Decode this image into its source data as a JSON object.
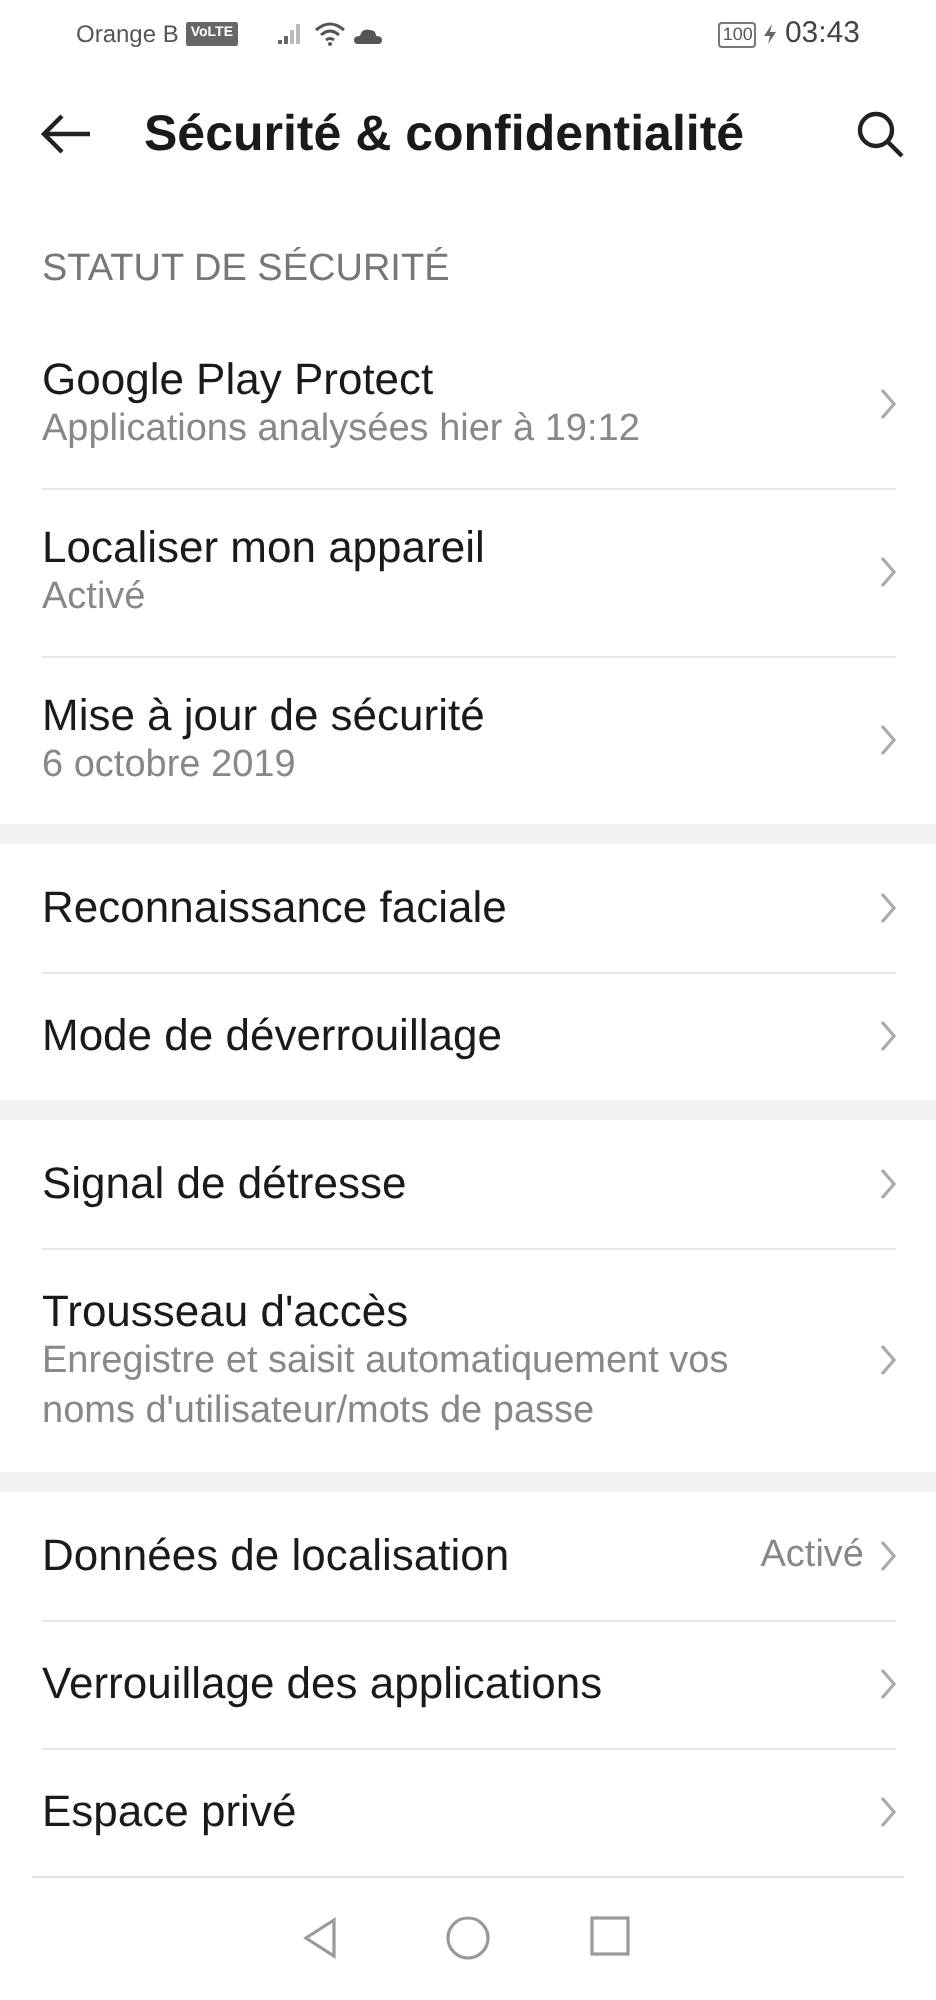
{
  "status_bar": {
    "carrier": "Orange B",
    "volte": "VoLTE",
    "battery": "100",
    "time": "03:43"
  },
  "header": {
    "title": "Sécurité & confidentialité"
  },
  "groups": [
    {
      "heading": "STATUT DE SÉCURITÉ",
      "items": [
        {
          "title": "Google Play Protect",
          "subtitle": "Applications analysées hier à 19:12"
        },
        {
          "title": "Localiser mon appareil",
          "subtitle": "Activé"
        },
        {
          "title": "Mise à jour de sécurité",
          "subtitle": "6 octobre 2019"
        }
      ]
    },
    {
      "items": [
        {
          "title": "Reconnaissance faciale"
        },
        {
          "title": "Mode de déverrouillage"
        }
      ]
    },
    {
      "items": [
        {
          "title": "Signal de détresse"
        },
        {
          "title": "Trousseau d'accès",
          "subtitle": "Enregistre et saisit automatiquement vos noms d'utilisateur/mots de passe"
        }
      ]
    },
    {
      "items": [
        {
          "title": "Données de localisation",
          "value": "Activé"
        },
        {
          "title": "Verrouillage des applications"
        },
        {
          "title": "Espace privé"
        }
      ]
    }
  ]
}
